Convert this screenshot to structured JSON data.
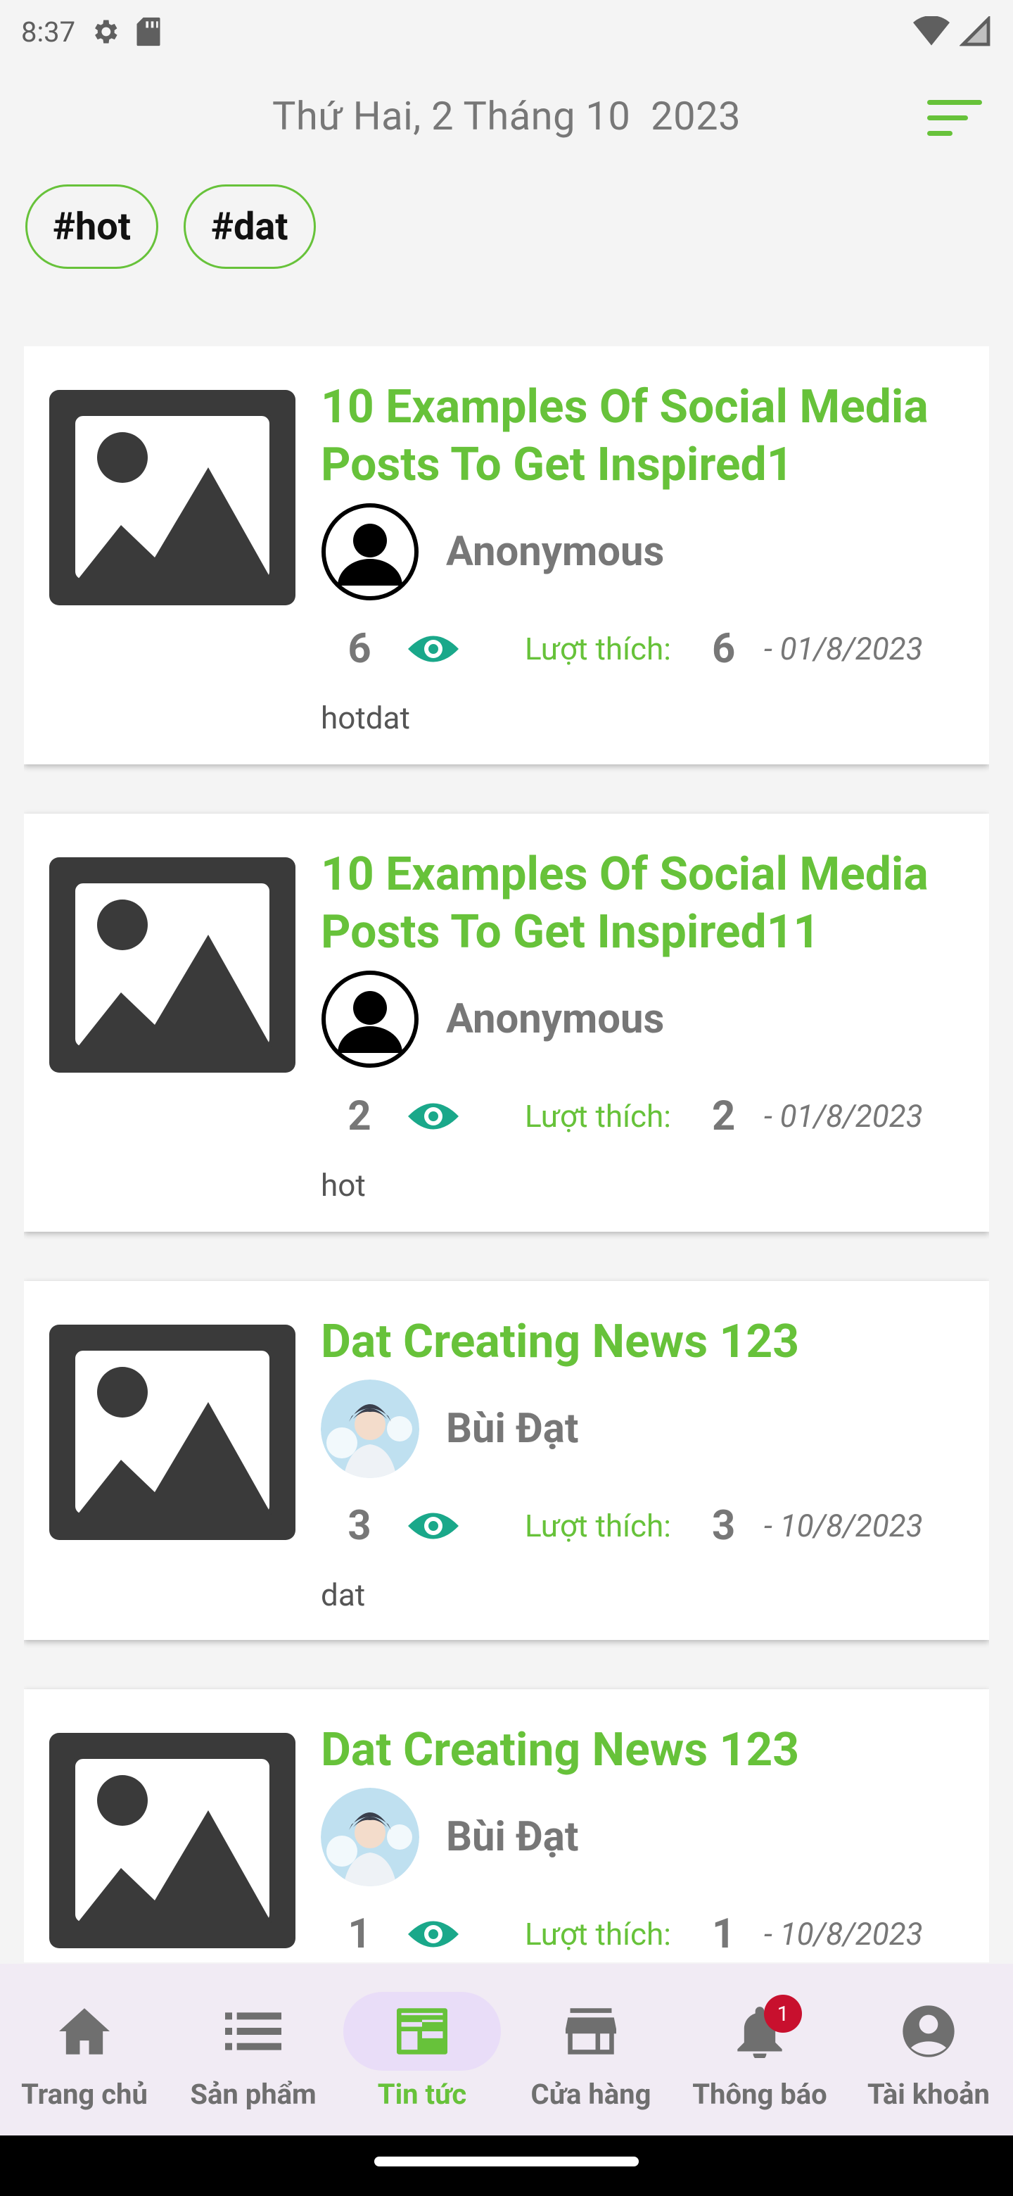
{
  "status": {
    "time": "8:37"
  },
  "header": {
    "date": "Thứ Hai, 2 Tháng 10  2023"
  },
  "tags": [
    "#hot",
    "#dat"
  ],
  "posts": [
    {
      "title": "10 Examples Of Social Media Posts To Get Inspired1",
      "author": "Anonymous",
      "avatar": "default",
      "views": "6",
      "likes_label": "Lượt thích:",
      "likes": "6",
      "date": "- 01/8/2023",
      "tags": "hotdat"
    },
    {
      "title": "10 Examples Of Social Media Posts To Get Inspired11",
      "author": "Anonymous",
      "avatar": "default",
      "views": "2",
      "likes_label": "Lượt thích:",
      "likes": "2",
      "date": "- 01/8/2023",
      "tags": "hot"
    },
    {
      "title": "Dat Creating News 123",
      "author": "Bùi Đạt",
      "avatar": "photo",
      "views": "3",
      "likes_label": "Lượt thích:",
      "likes": "3",
      "date": "- 10/8/2023",
      "tags": "dat"
    },
    {
      "title": "Dat Creating News 123",
      "author": "Bùi Đạt",
      "avatar": "photo",
      "views": "1",
      "likes_label": "Lượt thích:",
      "likes": "1",
      "date": "- 10/8/2023",
      "tags": ""
    }
  ],
  "nav": [
    {
      "label": "Trang chủ",
      "icon": "home-icon"
    },
    {
      "label": "Sản phẩm",
      "icon": "list-icon"
    },
    {
      "label": "Tin tức",
      "icon": "news-icon",
      "active": true
    },
    {
      "label": "Cửa hàng",
      "icon": "store-icon"
    },
    {
      "label": "Thông báo",
      "icon": "bell-icon",
      "badge": "1"
    },
    {
      "label": "Tài khoản",
      "icon": "account-icon"
    }
  ],
  "colors": {
    "accent": "#67c23a",
    "eye": "#1aa88a",
    "badge": "#c8102e"
  }
}
